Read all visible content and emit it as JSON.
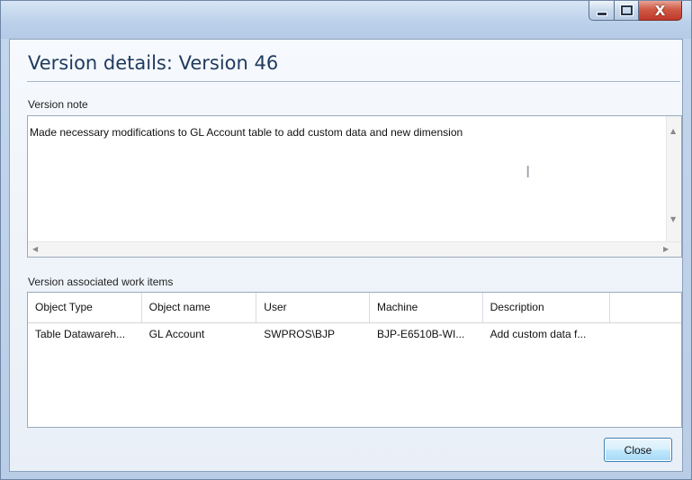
{
  "window": {
    "title_text": "",
    "caption": {
      "minimize_icon": "minimize-icon",
      "maximize_icon": "maximize-icon",
      "close_glyph": "X"
    }
  },
  "page": {
    "title": "Version details: Version 46"
  },
  "note": {
    "label": "Version note",
    "text": "Made necessary modifications to GL Account table to add custom data and new dimension",
    "cursor_glyph": "I",
    "scroll_up": "▲",
    "scroll_down": "▼",
    "scroll_left": "◀",
    "scroll_right": "▶"
  },
  "work_items": {
    "label": "Version associated work items",
    "columns": [
      "Object Type",
      "Object name",
      "User",
      "Machine",
      "Description",
      ""
    ],
    "rows": [
      [
        "Table Datawareh...",
        "GL Account",
        "SWPROS\\BJP",
        "BJP-E6510B-WI...",
        "Add custom data f...",
        ""
      ]
    ]
  },
  "buttons": {
    "close_label": "Close"
  },
  "colors": {
    "accent": "#1f3a5f",
    "button_border": "#3c7fb1",
    "close_caption": "#c0392b"
  }
}
